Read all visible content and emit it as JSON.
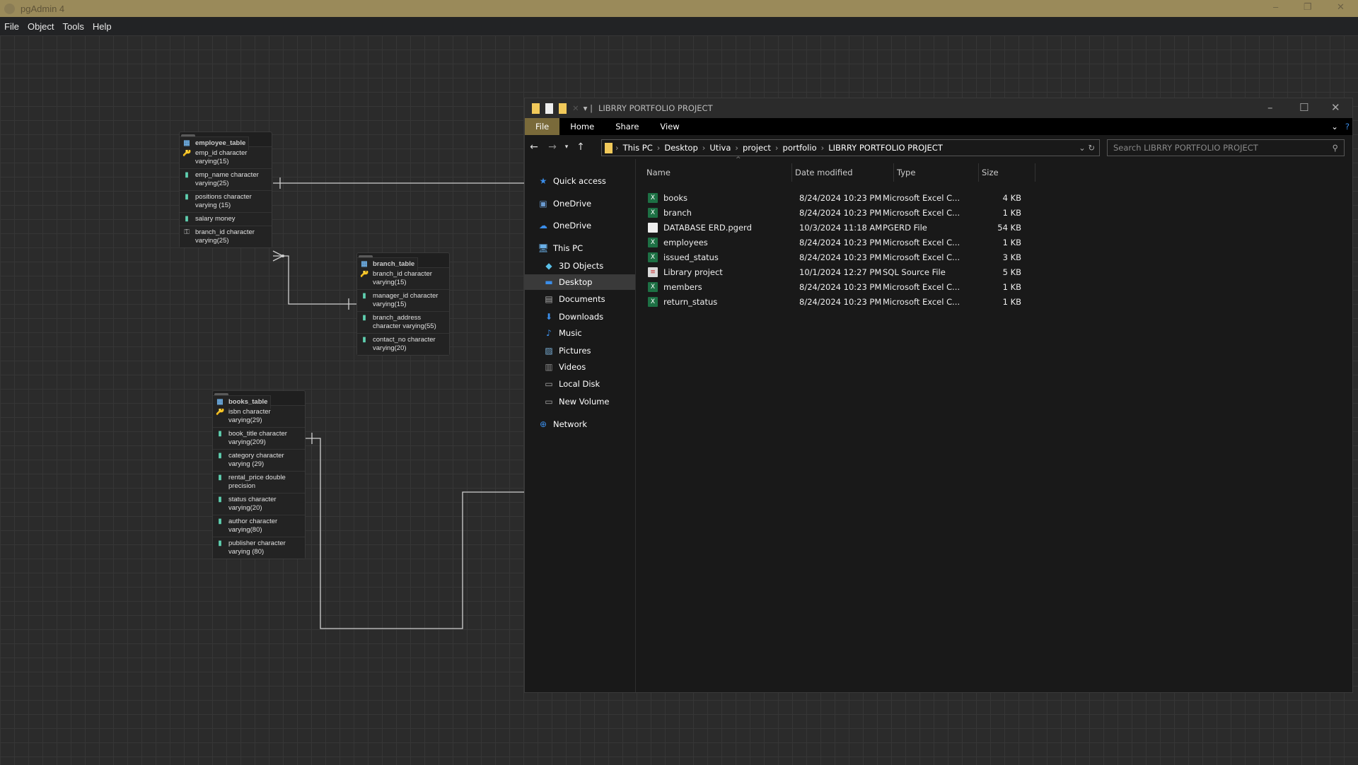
{
  "app": {
    "title": "pgAdmin 4",
    "menu": [
      "File",
      "Object",
      "Tools",
      "Help"
    ]
  },
  "erd": {
    "tables": [
      {
        "id": "employee",
        "schema": "public",
        "name": "employee_table",
        "columns": [
          {
            "kind": "pk",
            "text": "emp_id character varying(15)"
          },
          {
            "kind": "col",
            "text": "emp_name character varying(25)"
          },
          {
            "kind": "col",
            "text": "positions character varying (15)"
          },
          {
            "kind": "col",
            "text": "salary money"
          },
          {
            "kind": "fk",
            "text": "branch_id character varying(25)"
          }
        ]
      },
      {
        "id": "branch",
        "schema": "public",
        "name": "branch_table",
        "columns": [
          {
            "kind": "pk",
            "text": "branch_id character varying(15)"
          },
          {
            "kind": "col",
            "text": "manager_id character varying(15)"
          },
          {
            "kind": "col",
            "text": "branch_address character varying(55)"
          },
          {
            "kind": "col",
            "text": "contact_no character varying(20)"
          }
        ]
      },
      {
        "id": "books",
        "schema": "public",
        "name": "books_table",
        "columns": [
          {
            "kind": "pk",
            "text": "isbn character varying(29)"
          },
          {
            "kind": "col",
            "text": "book_title character varying(209)"
          },
          {
            "kind": "col",
            "text": "category character varying (29)"
          },
          {
            "kind": "col",
            "text": "rental_price double precision"
          },
          {
            "kind": "col",
            "text": "status character varying(20)"
          },
          {
            "kind": "col",
            "text": "author character varying(80)"
          },
          {
            "kind": "col",
            "text": "publisher character varying (80)"
          }
        ]
      }
    ]
  },
  "explorer": {
    "title": "LIBRRY PORTFOLIO PROJECT",
    "ribbon": [
      "File",
      "Home",
      "Share",
      "View"
    ],
    "breadcrumb": [
      "This PC",
      "Desktop",
      "Utiva",
      "project",
      "portfolio",
      "LIBRRY PORTFOLIO PROJECT"
    ],
    "search_placeholder": "Search LIBRRY PORTFOLIO PROJECT",
    "nav": [
      {
        "label": "Quick access",
        "icon": "star",
        "color": "#3b8eea"
      },
      {
        "label": "OneDrive",
        "icon": "folder-cloud",
        "color": "#6a9ad0"
      },
      {
        "label": "OneDrive",
        "icon": "cloud",
        "color": "#3b8eea"
      },
      {
        "label": "This PC",
        "icon": "computer",
        "color": "#6ab0e8"
      },
      {
        "label": "3D Objects",
        "icon": "cube",
        "color": "#5ac0e8"
      },
      {
        "label": "Desktop",
        "icon": "desktop",
        "color": "#3b8eea",
        "selected": true
      },
      {
        "label": "Documents",
        "icon": "document",
        "color": "#aaa"
      },
      {
        "label": "Downloads",
        "icon": "download",
        "color": "#3b8eea"
      },
      {
        "label": "Music",
        "icon": "music",
        "color": "#3b8eea"
      },
      {
        "label": "Pictures",
        "icon": "picture",
        "color": "#7ab0d8"
      },
      {
        "label": "Videos",
        "icon": "video",
        "color": "#888"
      },
      {
        "label": "Local Disk",
        "icon": "drive",
        "color": "#aaa"
      },
      {
        "label": "New Volume",
        "icon": "drive",
        "color": "#aaa"
      },
      {
        "label": "Network",
        "icon": "network",
        "color": "#3b8eea"
      }
    ],
    "columns": [
      "Name",
      "Date modified",
      "Type",
      "Size"
    ],
    "files": [
      {
        "name": "books",
        "date": "8/24/2024 10:23 PM",
        "type": "Microsoft Excel C...",
        "size": "4 KB",
        "icon": "excel"
      },
      {
        "name": "branch",
        "date": "8/24/2024 10:23 PM",
        "type": "Microsoft Excel C...",
        "size": "1 KB",
        "icon": "excel"
      },
      {
        "name": "DATABASE ERD.pgerd",
        "date": "10/3/2024 11:18 AM",
        "type": "PGERD File",
        "size": "54 KB",
        "icon": "file"
      },
      {
        "name": "employees",
        "date": "8/24/2024 10:23 PM",
        "type": "Microsoft Excel C...",
        "size": "1 KB",
        "icon": "excel"
      },
      {
        "name": "issued_status",
        "date": "8/24/2024 10:23 PM",
        "type": "Microsoft Excel C...",
        "size": "3 KB",
        "icon": "excel"
      },
      {
        "name": "Library project",
        "date": "10/1/2024 12:27 PM",
        "type": "SQL Source File",
        "size": "5 KB",
        "icon": "sql"
      },
      {
        "name": "members",
        "date": "8/24/2024 10:23 PM",
        "type": "Microsoft Excel C...",
        "size": "1 KB",
        "icon": "excel"
      },
      {
        "name": "return_status",
        "date": "8/24/2024 10:23 PM",
        "type": "Microsoft Excel C...",
        "size": "1 KB",
        "icon": "excel"
      }
    ]
  }
}
